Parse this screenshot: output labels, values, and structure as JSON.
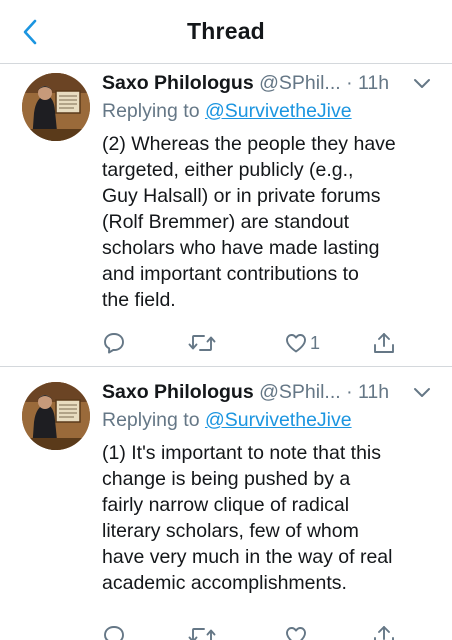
{
  "header": {
    "title": "Thread"
  },
  "tweets": [
    {
      "name": "Saxo Philologus",
      "handle": "@SPhil...",
      "separator": "·",
      "time": "11h",
      "replying_prefix": "Replying to",
      "replying_to": "@SurvivetheJive",
      "text_lines": [
        "(2) Whereas the people they have",
        "targeted, either publicly (e.g.,",
        "Guy Halsall) or in private forums",
        "(Rolf Bremmer) are standout",
        "scholars who have made lasting",
        "and important contributions to",
        "the field."
      ],
      "like_count": "1"
    },
    {
      "name": "Saxo Philologus",
      "handle": "@SPhil...",
      "separator": "·",
      "time": "11h",
      "replying_prefix": "Replying to",
      "replying_to": "@SurvivetheJive",
      "text_lines": [
        "(1) It's important to note that this",
        "change is being pushed by a",
        "fairly narrow clique of radical",
        "literary scholars, few of whom",
        "have very much in the way of real",
        "academic accomplishments."
      ],
      "like_count": ""
    }
  ],
  "icons": {
    "back": "chevron-left-icon",
    "caret": "chevron-down-icon",
    "reply": "speech-bubble-icon",
    "retweet": "retweet-icon",
    "like": "heart-icon",
    "share": "share-icon"
  },
  "colors": {
    "link": "#1b95e0",
    "secondary_text": "#657786",
    "divider": "#d4d8dc"
  }
}
